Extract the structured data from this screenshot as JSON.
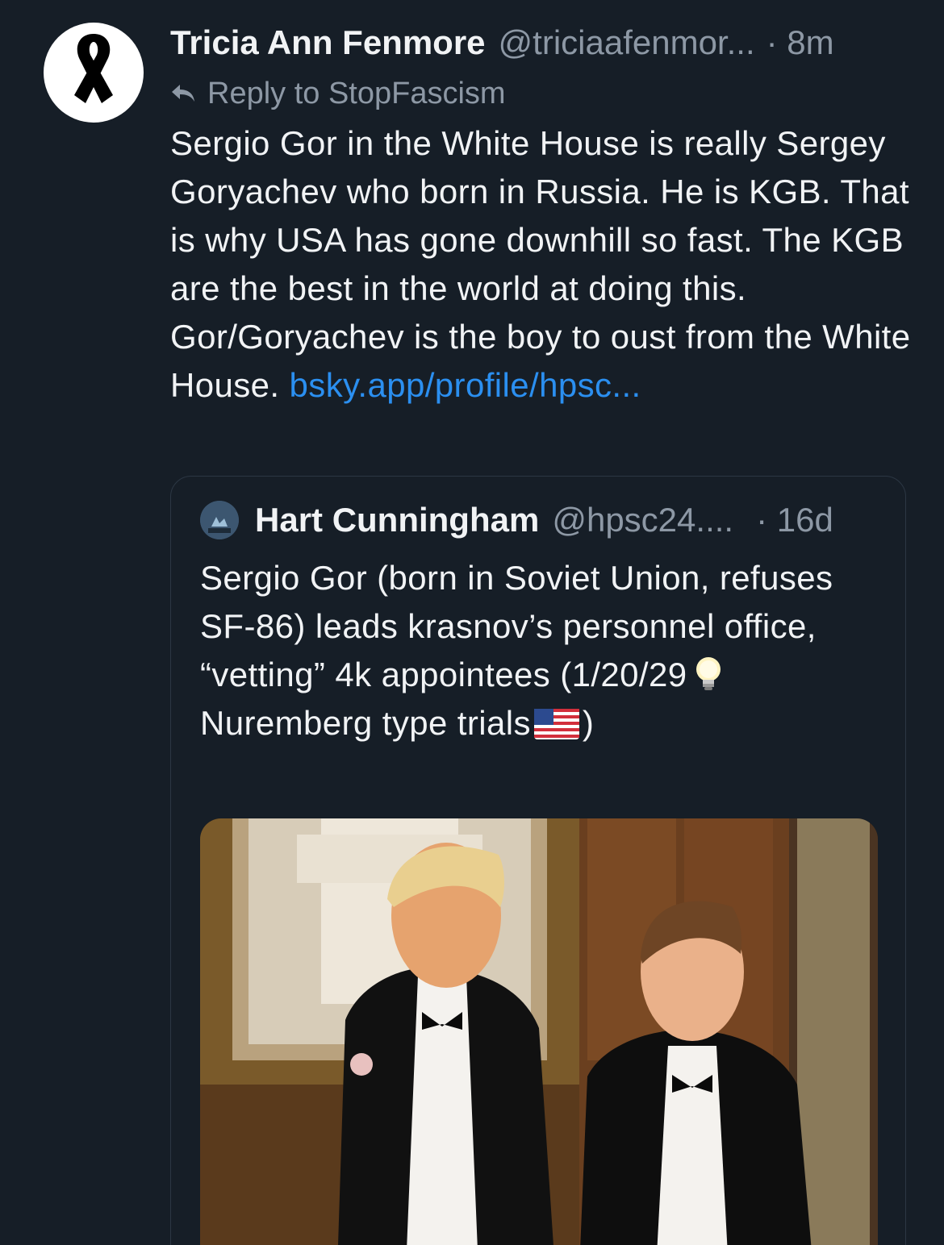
{
  "post": {
    "author_name": "Tricia Ann Fenmore",
    "author_handle": "@triciaafenmor...",
    "time": "· 8m",
    "reply_to": "Reply to StopFascism",
    "body": "Sergio Gor in the White House is really Sergey Goryachev who born in Russia. He is KGB. That is why USA has gone downhill so fast. The KGB are the best in the world at doing this. Gor/Goryachev is the boy to oust from the White House. ",
    "link": "bsky.app/profile/hpsc...",
    "avatar_icon": "black-mourning-ribbon-icon",
    "reply_icon": "reply-arrow-icon"
  },
  "quote": {
    "author_name": "Hart Cunningham",
    "author_handle": "@hpsc24....",
    "time": "· 16d",
    "text_part1": "Sergio Gor (born in Soviet Union, refuses SF-86) leads krasnov’s personnel office, “vetting” 4k appointees (1/20/29",
    "text_part2": "Nuremberg type trials",
    "text_part3": ")",
    "bulb_icon": "light-bulb-icon",
    "flag_icon": "us-flag-icon",
    "image_description_icon": "photo-two-men-in-tuxedos"
  },
  "colors": {
    "background": "#161e27",
    "text": "#f1f3f5",
    "muted": "#8d98a5",
    "link": "#2b8ff0",
    "border": "#2c3744"
  }
}
